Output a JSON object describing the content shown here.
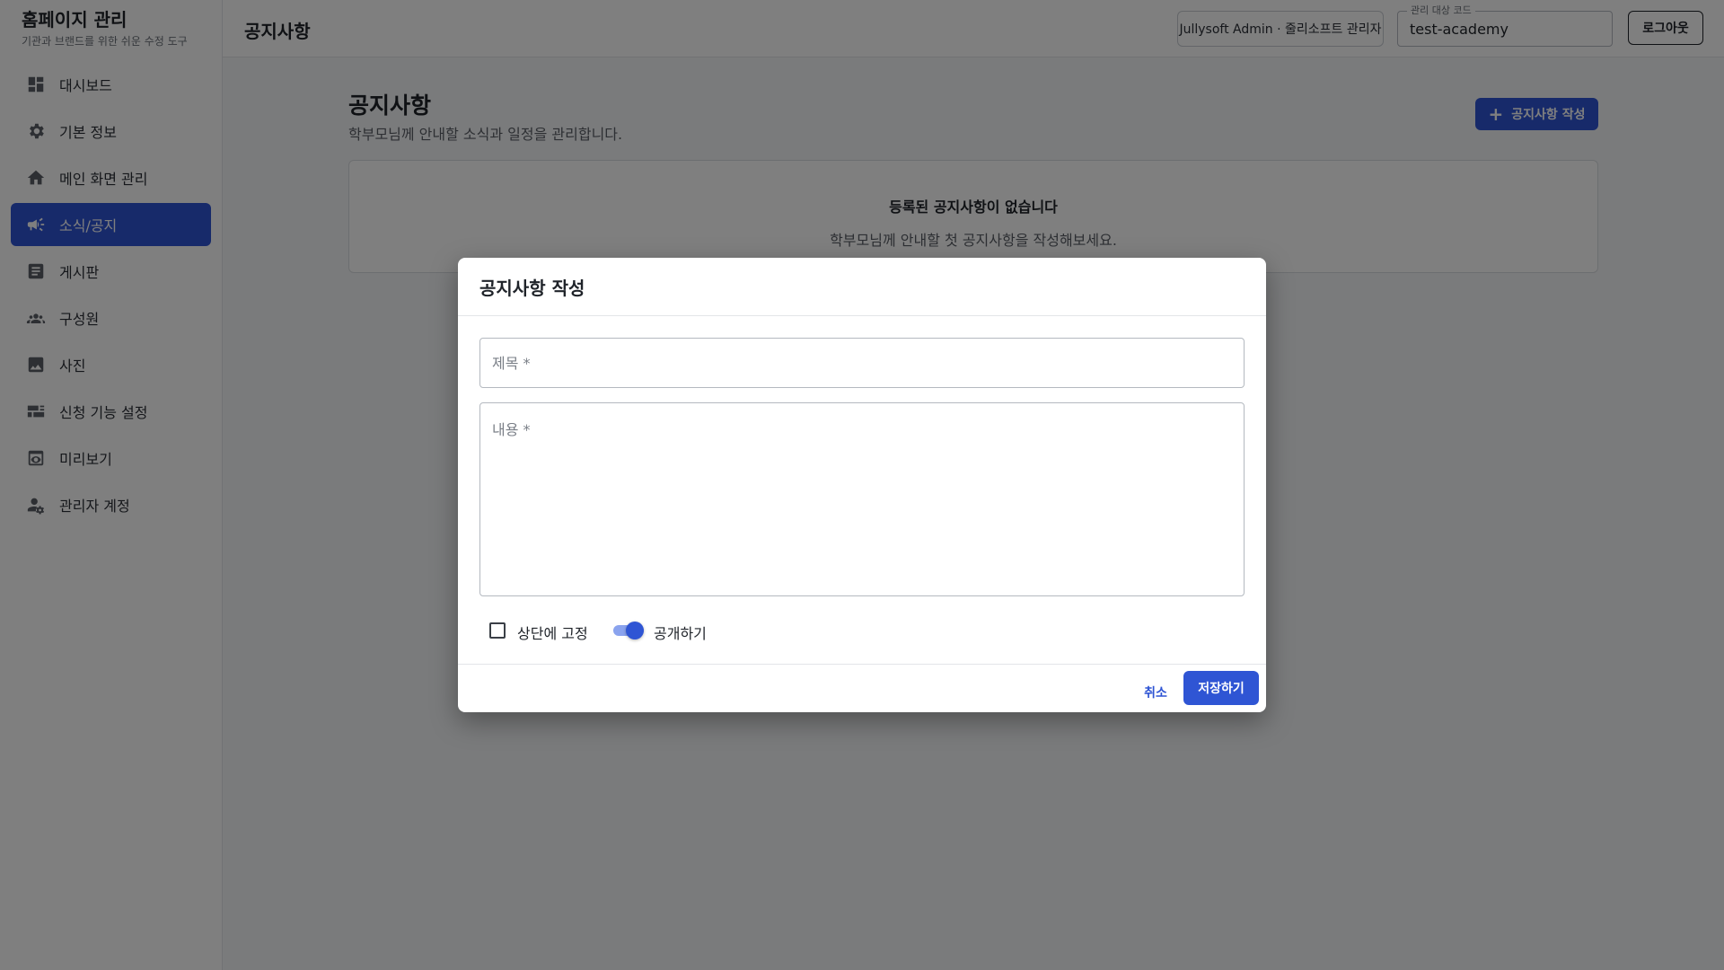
{
  "brand": {
    "title": "홈페이지 관리",
    "subtitle": "기관과 브랜드를 위한 쉬운 수정 도구"
  },
  "sidebar": {
    "items": [
      {
        "label": "대시보드",
        "icon": "dashboard-icon",
        "active": false
      },
      {
        "label": "기본 정보",
        "icon": "gear-icon",
        "active": false
      },
      {
        "label": "메인 화면 관리",
        "icon": "home-icon",
        "active": false
      },
      {
        "label": "소식/공지",
        "icon": "megaphone-icon",
        "active": true
      },
      {
        "label": "게시판",
        "icon": "article-icon",
        "active": false
      },
      {
        "label": "구성원",
        "icon": "people-icon",
        "active": false
      },
      {
        "label": "사진",
        "icon": "image-icon",
        "active": false
      },
      {
        "label": "신청 기능 설정",
        "icon": "forms-icon",
        "active": false
      },
      {
        "label": "미리보기",
        "icon": "preview-icon",
        "active": false
      },
      {
        "label": "관리자 계정",
        "icon": "admin-icon",
        "active": false
      }
    ]
  },
  "topbar": {
    "title": "공지사항",
    "user_label": "Jullysoft Admin · 줄리소프트 관리자",
    "code_label": "관리 대상 코드",
    "code_value": "test-academy",
    "logout_label": "로그아웃"
  },
  "main": {
    "heading": "공지사항",
    "description": "학부모님께 안내할 소식과 일정을 관리합니다.",
    "write_button": "공지사항 작성",
    "empty_title": "등록된 공지사항이 없습니다",
    "empty_desc": "학부모님께 안내할 첫 공지사항을 작성해보세요."
  },
  "dialog": {
    "title": "공지사항 작성",
    "title_placeholder": "제목 *",
    "content_placeholder": "내용 *",
    "pin_label": "상단에 고정",
    "pin_checked": false,
    "publish_label": "공개하기",
    "publish_on": true,
    "cancel_label": "취소",
    "save_label": "저장하기"
  },
  "colors": {
    "accent": "#2f55d4",
    "overlay": "rgba(0,0,0,0.5)"
  }
}
